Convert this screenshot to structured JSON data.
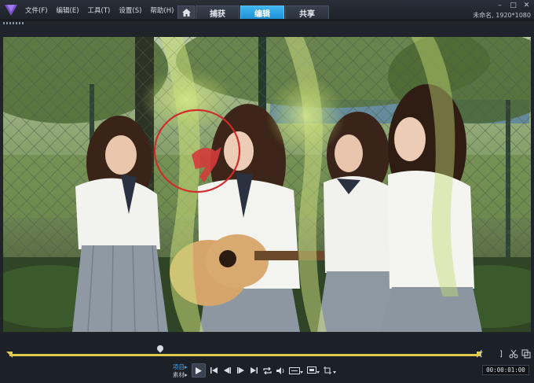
{
  "app": {
    "logo_icon": "videostudio-logo-icon",
    "project_info": "未命名, 1920*1080"
  },
  "menu": {
    "items": [
      {
        "label": "文件(F)"
      },
      {
        "label": "编辑(E)"
      },
      {
        "label": "工具(T)"
      },
      {
        "label": "设置(S)"
      },
      {
        "label": "帮助(H)"
      }
    ]
  },
  "tabs": {
    "home_icon": "home-icon",
    "items": [
      {
        "label": "捕获",
        "active": false
      },
      {
        "label": "编辑",
        "active": true
      },
      {
        "label": "共享",
        "active": false
      }
    ]
  },
  "preview": {
    "annotation": "red-circle-highlight",
    "accent_color": "#3fb6f0"
  },
  "playback": {
    "mode_project": "项目",
    "mode_clip": "素材",
    "mark_in": "[",
    "mark_out": "]",
    "timecode": "00:00:01:00"
  }
}
